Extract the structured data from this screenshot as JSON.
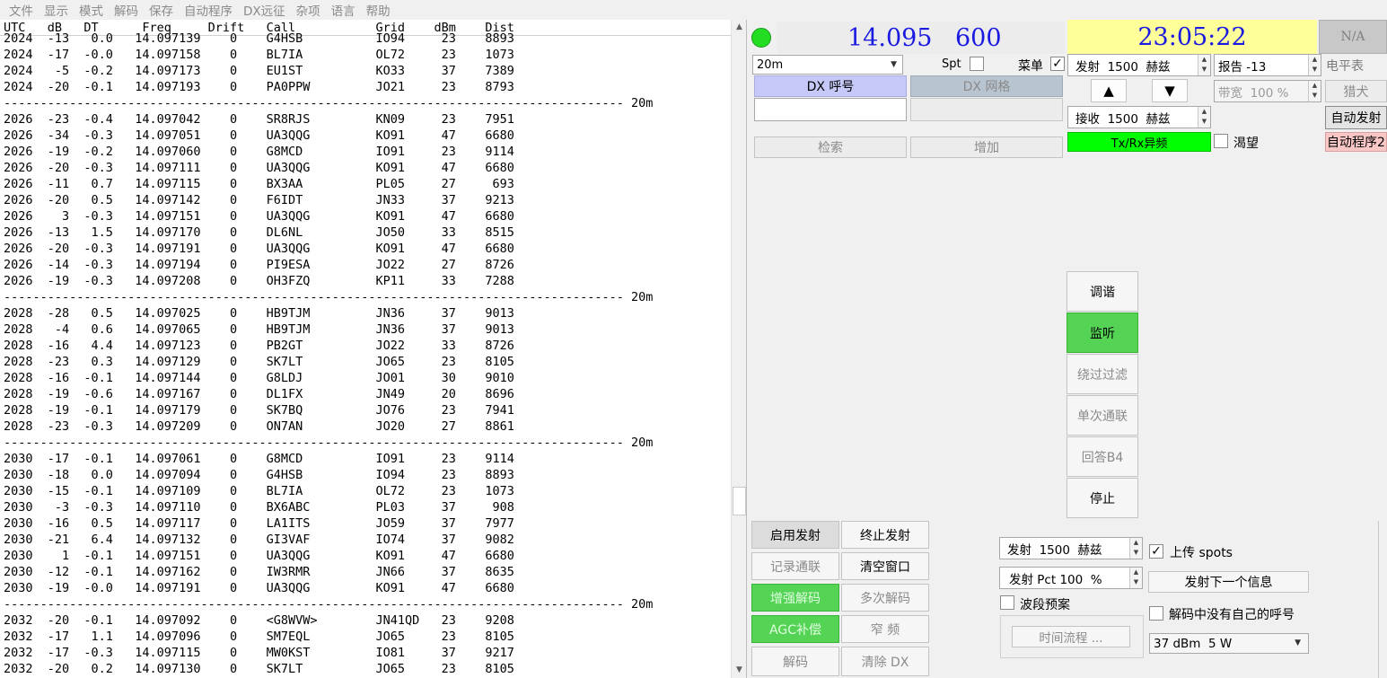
{
  "menu": [
    "文件",
    "显示",
    "模式",
    "解码",
    "保存",
    "自动程序",
    "DX远征",
    "杂项",
    "语言",
    "帮助"
  ],
  "decode": {
    "header": "UTC   dB   DT      Freq     Drift   Call           Grid    dBm    Dist",
    "lines": [
      "2024  -13   0.0   14.097139    0    G4HSB          IO94     23    8893",
      "2024  -17  -0.0   14.097158    0    BL7IA          OL72     23    1073",
      "2024   -5  -0.2   14.097173    0    EU1ST          KO33     37    7389",
      "2024  -20  -0.1   14.097193    0    PA0PPW         JO21     23    8793",
      "------------------------------------------------------------------------------------- 20m",
      "2026  -23  -0.4   14.097042    0    SR8RJS         KN09     23    7951",
      "2026  -34  -0.3   14.097051    0    UA3QQG         KO91     47    6680",
      "2026  -19  -0.2   14.097060    0    G8MCD          IO91     23    9114",
      "2026  -20  -0.3   14.097111    0    UA3QQG         KO91     47    6680",
      "2026  -11   0.7   14.097115    0    BX3AA          PL05     27     693",
      "2026  -20   0.5   14.097142    0    F6IDT          JN33     37    9213",
      "2026    3  -0.3   14.097151    0    UA3QQG         KO91     47    6680",
      "2026  -13   1.5   14.097170    0    DL6NL          JO50     33    8515",
      "2026  -20  -0.3   14.097191    0    UA3QQG         KO91     47    6680",
      "2026  -14  -0.3   14.097194    0    PI9ESA         JO22     27    8726",
      "2026  -19  -0.3   14.097208    0    OH3FZQ         KP11     33    7288",
      "------------------------------------------------------------------------------------- 20m",
      "2028  -28   0.5   14.097025    0    HB9TJM         JN36     37    9013",
      "2028   -4   0.6   14.097065    0    HB9TJM         JN36     37    9013",
      "2028  -16   4.4   14.097123    0    PB2GT          JO22     33    8726",
      "2028  -23   0.3   14.097129    0    SK7LT          JO65     23    8105",
      "2028  -16  -0.1   14.097144    0    G8LDJ          JO01     30    9010",
      "2028  -19  -0.6   14.097167    0    DL1FX          JN49     20    8696",
      "2028  -19  -0.1   14.097179    0    SK7BQ          JO76     23    7941",
      "2028  -23  -0.3   14.097209    0    ON7AN          JO20     27    8861",
      "------------------------------------------------------------------------------------- 20m",
      "2030  -17  -0.1   14.097061    0    G8MCD          IO91     23    9114",
      "2030  -18   0.0   14.097094    0    G4HSB          IO94     23    8893",
      "2030  -15  -0.1   14.097109    0    BL7IA          OL72     23    1073",
      "2030   -3  -0.3   14.097110    0    BX6ABC         PL03     37     908",
      "2030  -16   0.5   14.097117    0    LA1ITS         JO59     37    7977",
      "2030  -21   6.4   14.097132    0    GI3VAF         IO74     37    9082",
      "2030    1  -0.1   14.097151    0    UA3QQG         KO91     47    6680",
      "2030  -12  -0.1   14.097162    0    IW3RMR         JN66     37    8635",
      "2030  -19  -0.0   14.097191    0    UA3QQG         KO91     47    6680",
      "------------------------------------------------------------------------------------- 20m",
      "2032  -20  -0.1   14.097092    0    <G8WVW>        JN41QD   23    9208",
      "2032  -17   1.1   14.097096    0    SM7EQL         JO65     23    8105",
      "2032  -17  -0.3   14.097115    0    MW0KST         IO81     37    9217",
      "2032  -20   0.2   14.097130    0    SK7LT          JO65     23    8105"
    ]
  },
  "status": {
    "dial_freq": "14.095",
    "offset": "600",
    "clock": "23:05:22",
    "na": "N/A",
    "indicator_color": "#22dd22"
  },
  "controls": {
    "band": "20m",
    "spt_label": "Spt",
    "menu_label": "菜单",
    "menu_check": "✓",
    "dx_call_label": "DX 呼号",
    "dx_grid_label": "DX 网格",
    "search_label": "检索",
    "add_label": "增加",
    "tx_freq": "发射  1500  赫兹",
    "report": "报告 -13",
    "level_meter": "电平表",
    "bandwidth": "带宽  100 %",
    "hound": "猎犬",
    "rx_freq": "接收  1500  赫兹",
    "auto_tx": "自动发射",
    "split_label": "Tx/Rx异频",
    "desire_label": "渴望",
    "auto_prog": "自动程序2",
    "up_arrow": "▲",
    "down_arrow": "▼"
  },
  "actions": {
    "tune": "调谐",
    "monitor": "监听",
    "bypass_filter": "绕过过滤",
    "single_qso": "单次通联",
    "answer_b4": "回答B4",
    "stop": "停止",
    "enable_tx": "启用发射",
    "halt_tx": "终止发射",
    "log_qso": "记录通联",
    "clear_window": "清空窗口",
    "enhanced_decode": "增强解码",
    "multi_decode": "多次解码",
    "agc": "AGC补偿",
    "narrow": "窄 频",
    "decode": "解码",
    "clear_dx": "清除 DX"
  },
  "tx_panel": {
    "tx_freq2": "发射  1500  赫兹",
    "tx_pct": "发射 Pct 100  %",
    "band_plan": "波段预案",
    "schedule": "时间流程 ...",
    "upload_spots": "上传 spots",
    "upload_check": "✓",
    "send_next": "发射下一个信息",
    "no_own_call": "解码中没有自己的呼号",
    "power": "37 dBm  5 W"
  }
}
